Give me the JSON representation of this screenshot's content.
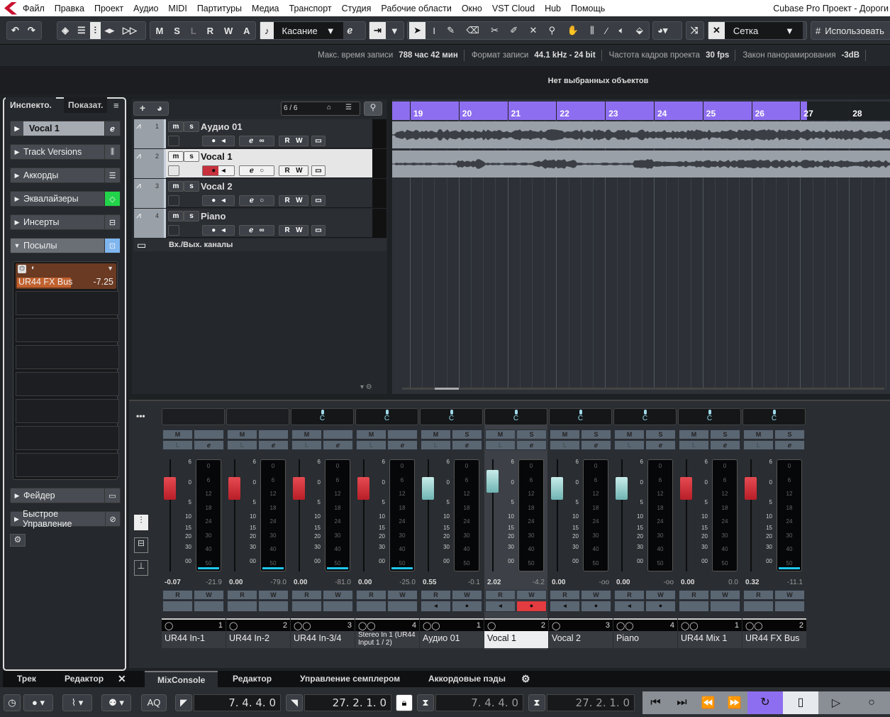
{
  "menu": {
    "items": [
      "Файл",
      "Правка",
      "Проект",
      "Аудио",
      "MIDI",
      "Партитуры",
      "Медиа",
      "Транспорт",
      "Студия",
      "Рабочие области",
      "Окно",
      "VST Cloud",
      "Hub",
      "Помощь"
    ],
    "title": "Cubase Pro Проект - Дороги"
  },
  "toolbar": {
    "msl": [
      "M",
      "S",
      "L",
      "R",
      "W",
      "A"
    ],
    "automation_mode": "Касание",
    "snap_type": "Сетка",
    "quantize_label": "Использовать"
  },
  "info": {
    "rec_time_label": "Макс. время записи",
    "rec_time": "788 час 42 мин",
    "format_label": "Формат записи",
    "format": "44.1 kHz - 24 bit",
    "fps_label": "Частота кадров проекта",
    "fps": "30 fps",
    "pan_label": "Закон панорамирования",
    "pan": "-3dB"
  },
  "no_selection": "Нет выбранных объектов",
  "inspector": {
    "tabs": [
      "Инспекто.",
      "Показат."
    ],
    "track": "Vocal 1",
    "sections": [
      {
        "label": "Track Versions",
        "open": false
      },
      {
        "label": "Аккорды",
        "open": false
      },
      {
        "label": "Эквалайзеры",
        "open": false
      },
      {
        "label": "Инсерты",
        "open": false
      },
      {
        "label": "Посылы",
        "open": true
      }
    ],
    "send": {
      "name": "UR44 FX Bus",
      "level": "-7.25"
    },
    "bottom_sections": [
      "Фейдер",
      "Быстрое Управление"
    ],
    "colors": {
      "eq_active": "#22d44a",
      "sends_active": "#7fb6f0",
      "send_slot": "#6b3a22"
    }
  },
  "tracklist": {
    "count": "6 / 6",
    "tracks": [
      {
        "num": "1",
        "name": "Аудио 01",
        "selected": false,
        "stereo": true
      },
      {
        "num": "2",
        "name": "Vocal 1",
        "selected": true,
        "stereo": false,
        "record": true
      },
      {
        "num": "3",
        "name": "Vocal 2",
        "selected": false,
        "stereo": false
      },
      {
        "num": "4",
        "name": "Piano",
        "selected": false,
        "stereo": true
      }
    ],
    "folder": "Вх./Вых. каналы"
  },
  "ruler": {
    "bars": [
      "19",
      "20",
      "21",
      "22",
      "23",
      "24",
      "25",
      "26",
      "27",
      "28"
    ],
    "cycle_color": "#8e6ef0"
  },
  "mixer": {
    "fader_scale": [
      "6",
      "0",
      "5",
      "10",
      "15",
      "20",
      "30",
      "00"
    ],
    "meter_scale": [
      "0",
      "6",
      "12",
      "18",
      "24",
      "30",
      "40",
      "50"
    ],
    "channels": [
      {
        "name": "UR44 In-1",
        "num": "1",
        "stereo": false,
        "volume": "-0.07",
        "peak": "-21.9",
        "fader": "red",
        "pan": false,
        "monitor": false
      },
      {
        "name": "UR44 In-2",
        "num": "2",
        "stereo": false,
        "volume": "0.00",
        "peak": "-79.0",
        "fader": "red",
        "pan": false,
        "monitor": false
      },
      {
        "name": "UR44 In-3/4",
        "num": "3",
        "stereo": true,
        "volume": "0.00",
        "peak": "-81.0",
        "fader": "red",
        "pan": true,
        "monitor": false
      },
      {
        "name": "Stereo In 1 (UR44 Input 1 / 2)",
        "num": "4",
        "stereo": true,
        "volume": "0.00",
        "peak": "-25.0",
        "fader": "red",
        "pan": true,
        "monitor": false
      },
      {
        "name": "Аудио 01",
        "num": "1",
        "stereo": true,
        "volume": "0.55",
        "peak": "-0.1",
        "fader": "teal",
        "pan": true,
        "monitor": true
      },
      {
        "name": "Vocal 1",
        "num": "2",
        "stereo": false,
        "volume": "2.02",
        "peak": "-4.2",
        "fader": "teal",
        "pan": true,
        "monitor": true,
        "record": true,
        "selected": true
      },
      {
        "name": "Vocal 2",
        "num": "3",
        "stereo": false,
        "volume": "0.00",
        "peak": "-oo",
        "fader": "teal",
        "pan": true,
        "monitor": true
      },
      {
        "name": "Piano",
        "num": "4",
        "stereo": true,
        "volume": "0.00",
        "peak": "-oo",
        "fader": "teal",
        "pan": true,
        "monitor": true
      },
      {
        "name": "UR44 Mix 1",
        "num": "1",
        "stereo": true,
        "volume": "0.00",
        "peak": "0.0",
        "fader": "red",
        "pan": true,
        "monitor": false
      },
      {
        "name": "UR44 FX Bus",
        "num": "2",
        "stereo": true,
        "volume": "0.32",
        "peak": "-11.1",
        "fader": "red",
        "pan": true,
        "monitor": false
      }
    ]
  },
  "left_tabs": [
    "Трек",
    "Редактор"
  ],
  "bottom_tabs": [
    "MixConsole",
    "Редактор",
    "Управление семплером",
    "Аккордовые пэды"
  ],
  "transport": {
    "left_locator": "7. 4. 4.   0",
    "right_locator": "27. 2. 1.   0",
    "punch_in": "7. 4. 4.   0",
    "punch_out": "27. 2. 1.   0",
    "aq": "AQ",
    "cycle_active": true
  }
}
